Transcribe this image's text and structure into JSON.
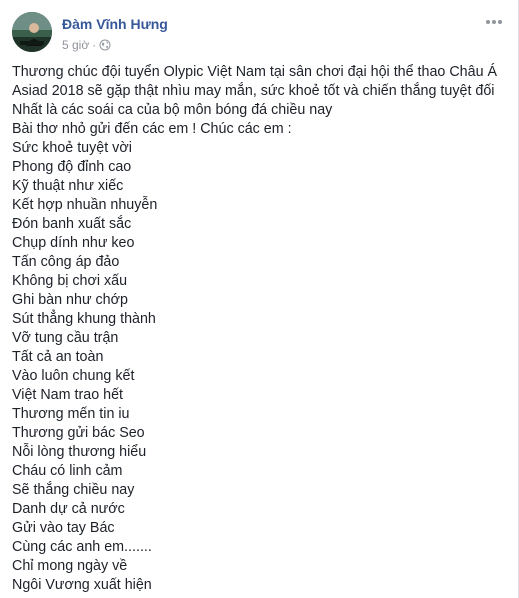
{
  "post": {
    "author": "Đàm Vĩnh Hưng",
    "time": "5 giờ",
    "separator": "·",
    "privacy_icon": "globe-icon",
    "more_icon": "more-horizontal-icon",
    "avatar_icon": "profile-photo",
    "lines": [
      "Thương chúc đội tuyển Olypic Việt Nam tại sân chơi đại hội thể thao Châu Á",
      "Asiad 2018 sẽ gặp thật nhìu may mắn, sức khoẻ tốt và chiến thắng tuyệt đối",
      "Nhất là các soái ca của bộ môn bóng đá chiều nay",
      "Bài thơ nhỏ gửi đến các em ! Chúc các em :",
      "Sức khoẻ tuyệt vời",
      "Phong độ đỉnh cao",
      "Kỹ thuật như xiếc",
      "Kết hợp nhuần nhuyễn",
      "Đón banh xuất sắc",
      "Chụp dính như keo",
      "Tấn công áp đảo",
      "Không bị chơi xấu",
      "Ghi bàn như chớp",
      "Sút thẳng khung thành",
      "Vỡ tung cầu trận",
      "Tất cả an toàn",
      "Vào luôn chung kết",
      "Việt Nam trao hết",
      "Thương mến tin iu",
      "Thương gửi bác Seo",
      "Nỗi lòng thương hiểu",
      "Cháu có linh cảm",
      "Sẽ thắng chiều nay",
      "Danh dự cả nước",
      "Gửi vào tay Bác",
      "Cùng các anh em.......",
      "Chỉ mong ngày về",
      "Ngôi Vương xuất hiện"
    ]
  },
  "colors": {
    "author": "#365899",
    "meta": "#90949c",
    "text": "#1d2129"
  }
}
